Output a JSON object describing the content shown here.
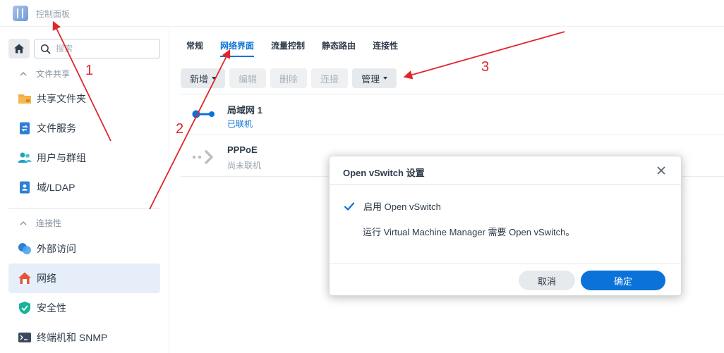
{
  "app": {
    "title": "控制面板",
    "icon": "control-panel-icon"
  },
  "search": {
    "placeholder": "搜索",
    "value": ""
  },
  "sidebar": {
    "sections": [
      {
        "label": "文件共享",
        "icon": "chevron-up-icon"
      },
      {
        "label": "连接性",
        "icon": "chevron-up-icon"
      }
    ],
    "items": [
      {
        "label": "共享文件夹",
        "icon": "shared-folder-icon"
      },
      {
        "label": "文件服务",
        "icon": "file-services-icon"
      },
      {
        "label": "用户与群组",
        "icon": "users-icon"
      },
      {
        "label": "域/LDAP",
        "icon": "domain-icon"
      },
      {
        "label": "外部访问",
        "icon": "external-access-icon"
      },
      {
        "label": "网络",
        "icon": "network-icon",
        "active": true
      },
      {
        "label": "安全性",
        "icon": "shield-icon"
      },
      {
        "label": "终端机和 SNMP",
        "icon": "terminal-icon"
      }
    ]
  },
  "tabs": [
    {
      "label": "常规"
    },
    {
      "label": "网络界面",
      "active": true
    },
    {
      "label": "流量控制"
    },
    {
      "label": "静态路由"
    },
    {
      "label": "连接性"
    }
  ],
  "toolbar": {
    "add_label": "新增",
    "edit_label": "编辑",
    "delete_label": "删除",
    "connect_label": "连接",
    "manage_label": "管理"
  },
  "interfaces": [
    {
      "name": "局域网 1",
      "status": "已联机",
      "connected": true,
      "icon": "lan-icon"
    },
    {
      "name": "PPPoE",
      "status": "尚未联机",
      "connected": false,
      "icon": "pppoe-icon"
    }
  ],
  "dialog": {
    "title": "Open vSwitch 设置",
    "checkbox_label": "启用 Open vSwitch",
    "checked": true,
    "description": "运行 Virtual Machine Manager 需要 Open vSwitch。",
    "cancel_label": "取消",
    "ok_label": "确定"
  },
  "annotations": [
    {
      "label": "1"
    },
    {
      "label": "2"
    },
    {
      "label": "3"
    }
  ],
  "colors": {
    "accent": "#0a72d8",
    "annotation": "#e0262b",
    "active_bg": "#e6eef9"
  }
}
